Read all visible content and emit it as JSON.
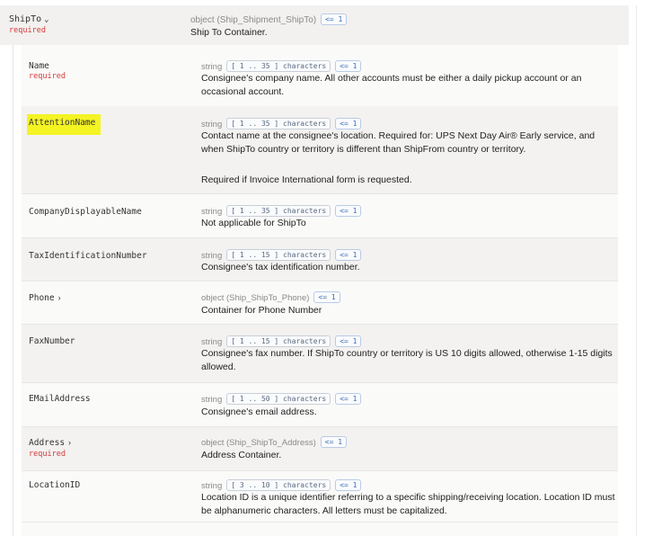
{
  "ship_to": {
    "name": "ShipTo",
    "required": "required",
    "type": "object (Ship_Shipment_ShipTo)",
    "badge": "<= 1",
    "description": "Ship To Container."
  },
  "properties": [
    {
      "name": "Name",
      "required": "required",
      "type": "string",
      "constraint": "[ 1 .. 35 ] characters",
      "badge": "<= 1",
      "description": "Consignee's company name. All other accounts must be either a daily pickup account or an occasional account.",
      "expandable": false
    },
    {
      "name": "AttentionName",
      "required": "",
      "type": "string",
      "constraint": "[ 1 .. 35 ] characters",
      "badge": "<= 1",
      "description": "Contact name at the consignee's location. Required for: UPS Next Day Air® Early service, and when ShipTo country or territory is different than ShipFrom country or territory.",
      "description2": "Required if Invoice International form is requested.",
      "highlighted": true,
      "expandable": false
    },
    {
      "name": "CompanyDisplayableName",
      "required": "",
      "type": "string",
      "constraint": "[ 1 .. 35 ] characters",
      "badge": "<= 1",
      "description": "Not applicable for ShipTo",
      "expandable": false
    },
    {
      "name": "TaxIdentificationNumber",
      "required": "",
      "type": "string",
      "constraint": "[ 1 .. 15 ] characters",
      "badge": "<= 1",
      "description": "Consignee's tax identification number.",
      "expandable": false
    },
    {
      "name": "Phone",
      "required": "",
      "type": "object (Ship_ShipTo_Phone)",
      "constraint": "",
      "badge": "<= 1",
      "description": "Container for Phone Number",
      "expandable": true
    },
    {
      "name": "FaxNumber",
      "required": "",
      "type": "string",
      "constraint": "[ 1 .. 15 ] characters",
      "badge": "<= 1",
      "description": "Consignee's fax number. If ShipTo country or territory is US 10 digits allowed, otherwise 1-15 digits allowed.",
      "expandable": false
    },
    {
      "name": "EMailAddress",
      "required": "",
      "type": "string",
      "constraint": "[ 1 .. 50 ] characters",
      "badge": "<= 1",
      "description": "Consignee's email address.",
      "expandable": false
    },
    {
      "name": "Address",
      "required": "required",
      "type": "object (Ship_ShipTo_Address)",
      "constraint": "",
      "badge": "<= 1",
      "description": "Address Container.",
      "expandable": true
    },
    {
      "name": "LocationID",
      "required": "",
      "type": "string",
      "constraint": "[ 3 .. 10 ] characters",
      "badge": "<= 1",
      "description": "Location ID is a unique identifier referring to a specific shipping/receiving location. Location ID must be alphanumeric characters. All letters must be capitalized.",
      "expandable": false
    }
  ],
  "colors": {
    "required": "#d43939",
    "highlight": "#f4f323",
    "badge_text": "#3c6fb3"
  }
}
